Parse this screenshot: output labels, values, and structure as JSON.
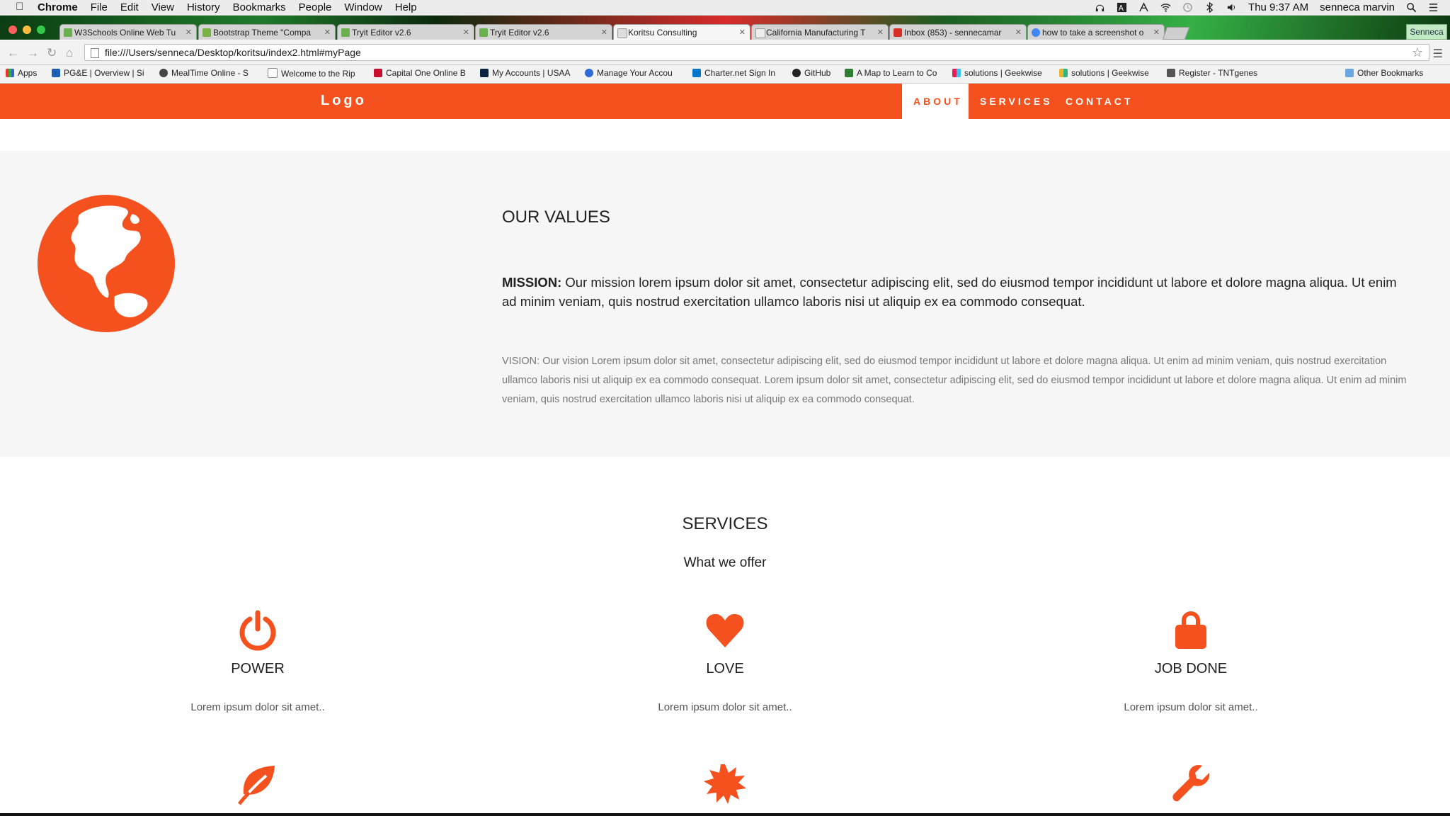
{
  "os_menubar": {
    "app_name": "Chrome",
    "menus": [
      "File",
      "Edit",
      "View",
      "History",
      "Bookmarks",
      "People",
      "Window",
      "Help"
    ],
    "clock": "Thu 9:37 AM",
    "user": "senneca marvin"
  },
  "browser": {
    "tabs": [
      {
        "title": "W3Schools Online Web Tu"
      },
      {
        "title": "Bootstrap Theme \"Compa"
      },
      {
        "title": "Tryit Editor v2.6"
      },
      {
        "title": "Tryit Editor v2.6"
      },
      {
        "title": "Koritsu Consulting"
      },
      {
        "title": "California Manufacturing T"
      },
      {
        "title": "Inbox (853) - sennecamar"
      },
      {
        "title": "how to take a screenshot o"
      }
    ],
    "profile": "Senneca",
    "url": "file:///Users/senneca/Desktop/koritsu/index2.html#myPage",
    "bookmarks": [
      "Apps",
      "PG&E | Overview | Si",
      "MealTime Online - S",
      "Welcome to the Rip",
      "Capital One Online B",
      "My Accounts | USAA",
      "Manage Your Accou",
      "Charter.net Sign In",
      "GitHub",
      "A Map to Learn to Co",
      "solutions | Geekwise",
      "solutions | Geekwise",
      "Register - TNTgenes",
      "Other Bookmarks"
    ]
  },
  "site": {
    "logo": "Logo",
    "nav": [
      "ABOUT",
      "SERVICES",
      "CONTACT"
    ],
    "about": {
      "title": "OUR VALUES",
      "mission_label": "MISSION:",
      "mission_text": " Our mission lorem ipsum dolor sit amet, consectetur adipiscing elit, sed do eiusmod tempor incididunt ut labore et dolore magna aliqua. Ut enim ad minim veniam, quis nostrud exercitation ullamco laboris nisi ut aliquip ex ea commodo consequat.",
      "vision_text": "VISION: Our vision Lorem ipsum dolor sit amet, consectetur adipiscing elit, sed do eiusmod tempor incididunt ut labore et dolore magna aliqua. Ut enim ad minim veniam, quis nostrud exercitation ullamco laboris nisi ut aliquip ex ea commodo consequat. Lorem ipsum dolor sit amet, consectetur adipiscing elit, sed do eiusmod tempor incididunt ut labore et dolore magna aliqua. Ut enim ad minim veniam, quis nostrud exercitation ullamco laboris nisi ut aliquip ex ea commodo consequat."
    },
    "services": {
      "title": "SERVICES",
      "subtitle": "What we offer",
      "items": [
        {
          "name": "POWER",
          "desc": "Lorem ipsum dolor sit amet..",
          "icon": "power-icon"
        },
        {
          "name": "LOVE",
          "desc": "Lorem ipsum dolor sit amet..",
          "icon": "heart-icon"
        },
        {
          "name": "JOB DONE",
          "desc": "Lorem ipsum dolor sit amet..",
          "icon": "lock-icon"
        }
      ],
      "row2_icons": [
        "leaf-icon",
        "certificate-icon",
        "wrench-icon"
      ]
    },
    "accent": "#f4511e"
  }
}
